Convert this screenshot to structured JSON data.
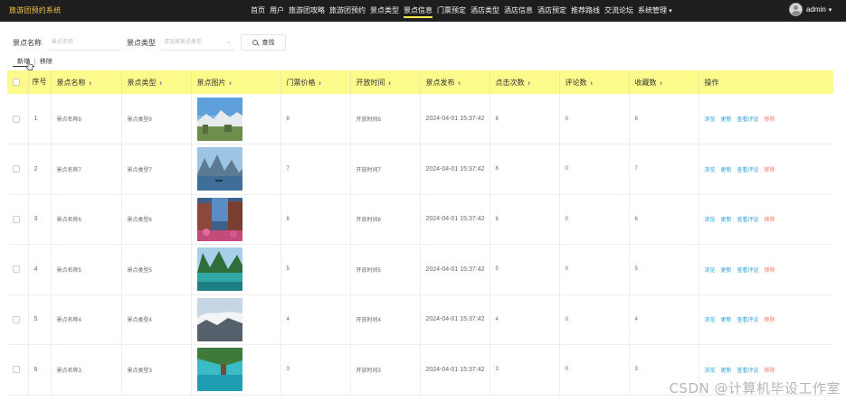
{
  "app": {
    "title": "旅游团预约系统"
  },
  "nav": {
    "items": [
      "首页",
      "用户",
      "旅游团攻略",
      "旅游团预约",
      "景点类型",
      "景点信息",
      "门票预定",
      "酒店类型",
      "酒店信息",
      "酒店预定",
      "推荐路线",
      "交流论坛",
      "系统管理"
    ],
    "active_index": 5,
    "system_caret": "▾"
  },
  "user": {
    "name": "admin",
    "caret": "▾"
  },
  "search": {
    "name_label": "景点名称",
    "name_placeholder": "景点名称",
    "type_label": "景点类型",
    "type_placeholder": "请选择景点类型",
    "button": "查找"
  },
  "actions": {
    "add": "新增",
    "remove": "移除"
  },
  "table": {
    "headers": [
      "序号",
      "景点名称",
      "景点类型",
      "景点图片",
      "门票价格",
      "开放时间",
      "景点发布",
      "点击次数",
      "评论数",
      "收藏数",
      "操作"
    ],
    "sort_icon": "⬍",
    "rows": [
      {
        "idx": "1",
        "name": "景点名称8",
        "type": "景点类型8",
        "price": "8",
        "time": "开放时间8",
        "date": "2024-04-01 15:37:42",
        "clicks": "8",
        "comments": "0",
        "favs": "8"
      },
      {
        "idx": "2",
        "name": "景点名称7",
        "type": "景点类型7",
        "price": "7",
        "time": "开放时间7",
        "date": "2024-04-01 15:37:42",
        "clicks": "8",
        "comments": "0",
        "favs": "7"
      },
      {
        "idx": "3",
        "name": "景点名称6",
        "type": "景点类型6",
        "price": "6",
        "time": "开放时间6",
        "date": "2024-04-01 15:37:42",
        "clicks": "6",
        "comments": "0",
        "favs": "6"
      },
      {
        "idx": "4",
        "name": "景点名称5",
        "type": "景点类型5",
        "price": "5",
        "time": "开放时间5",
        "date": "2024-04-01 15:37:42",
        "clicks": "5",
        "comments": "0",
        "favs": "5"
      },
      {
        "idx": "5",
        "name": "景点名称4",
        "type": "景点类型4",
        "price": "4",
        "time": "开放时间4",
        "date": "2024-04-01 15:37:42",
        "clicks": "4",
        "comments": "0",
        "favs": "4"
      },
      {
        "idx": "6",
        "name": "景点名称3",
        "type": "景点类型3",
        "price": "3",
        "time": "开放时间3",
        "date": "2024-04-01 15:37:42",
        "clicks": "3",
        "comments": "0",
        "favs": "3"
      }
    ],
    "ops": {
      "view": "浏览",
      "edit": "更新",
      "review": "查看评论",
      "del": "移除"
    }
  },
  "watermark": "CSDN @计算机毕设工作室",
  "colors": {
    "header_bg": "#fbfa8b",
    "topbar_bg": "#1e1e1e",
    "link": "#2c9fd6",
    "danger": "#f4795b",
    "brand": "#f2c94c"
  }
}
